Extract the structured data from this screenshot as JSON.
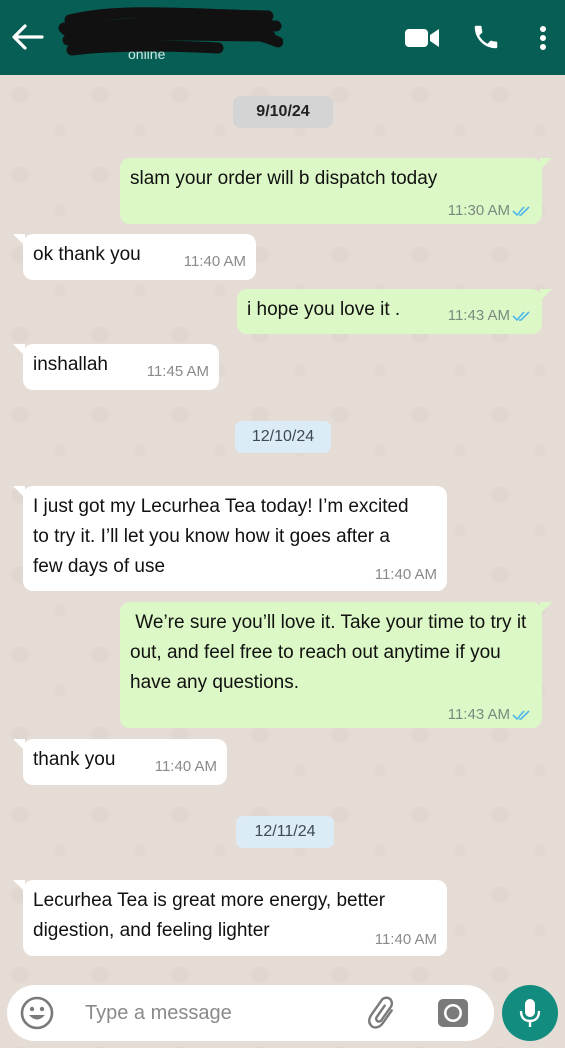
{
  "header": {
    "status": "online",
    "icons": [
      "back-arrow-icon",
      "video-call-icon",
      "phone-call-icon",
      "more-options-icon"
    ],
    "background_color": "#075e54"
  },
  "chat": {
    "dates": [
      "9/10/24",
      "12/10/24",
      "12/11/24"
    ],
    "messages": [
      {
        "direction": "outgoing",
        "text": "slam your order will b dispatch today",
        "time": "11:30 AM",
        "status": "read"
      },
      {
        "direction": "incoming",
        "text": "ok thank you",
        "time": "11:40 AM"
      },
      {
        "direction": "outgoing",
        "text": "i hope you love it .",
        "time": "11:43 AM",
        "status": "read"
      },
      {
        "direction": "incoming",
        "text": "inshallah",
        "time": "11:45 AM"
      },
      {
        "direction": "incoming",
        "text": "I just got my Lecurhea Tea today! I’m excited to try it. I’ll let you know how it goes after a few days of use",
        "time": "11:40 AM"
      },
      {
        "direction": "outgoing",
        "text": " We’re sure you’ll love it. Take your time to try it out, and feel free to reach out anytime if you have any questions.",
        "time": "11:43 AM",
        "status": "read"
      },
      {
        "direction": "incoming",
        "text": "thank you",
        "time": "11:40 AM"
      },
      {
        "direction": "incoming",
        "text": "Lecurhea Tea is great more energy, better digestion, and feeling lighter",
        "time": "11:40 AM"
      }
    ],
    "outgoing_color": "#dcf8c6",
    "incoming_color": "#ffffff",
    "read_tick_color": "#4fb6ec"
  },
  "composer": {
    "placeholder": "Type a message",
    "value": "",
    "icons": [
      "emoji-icon",
      "attach-icon",
      "camera-icon",
      "microphone-icon"
    ],
    "mic_color": "#128c7e"
  }
}
